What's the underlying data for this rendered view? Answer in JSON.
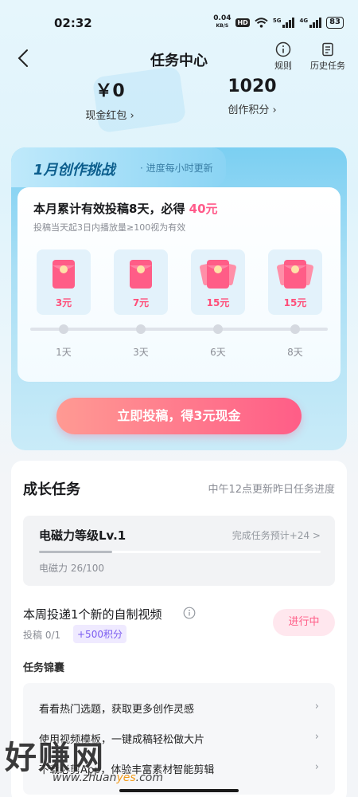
{
  "status_bar": {
    "time": "02:32",
    "net_speed_value": "0.04",
    "net_speed_unit": "KB/S",
    "hd": "HD",
    "signal1": "5G",
    "signal2": "4G",
    "battery": "83"
  },
  "nav": {
    "title": "任务中心",
    "rules": "规则",
    "history": "历史任务"
  },
  "stats": {
    "cash_value": "￥0",
    "cash_label": "现金红包 ›",
    "points_value": "1020",
    "points_label": "创作积分 ›"
  },
  "challenge": {
    "title": "1月创作挑战",
    "subtitle": "· 进度每小时更新",
    "headline_prefix": "本月累计有效投稿8天，必得 ",
    "headline_amount": "40元",
    "note": "投稿当天起3日内播放量≥100视为有效",
    "rewards": [
      {
        "amount": "3元",
        "day": "1天"
      },
      {
        "amount": "7元",
        "day": "3天"
      },
      {
        "amount": "15元",
        "day": "6天"
      },
      {
        "amount": "15元",
        "day": "8天"
      }
    ],
    "cta": "立即投稿，得3元现金"
  },
  "growth": {
    "title": "成长任务",
    "hint": "中午12点更新昨日任务进度",
    "level_name": "电磁力等级Lv.1",
    "level_link": "完成任务预计+24 >",
    "level_value": "电磁力 26/100",
    "level_progress": 0.26,
    "task_title": "本周投递1个新的自制视频",
    "task_progress": "投稿 0/1",
    "task_points": "+500积分",
    "task_status": "进行中",
    "bag_title": "任务锦囊",
    "bag_items": [
      "看看热门选题，获取更多创作灵感",
      "使用视频模板，一键成稿轻松做大片",
      "下载必剪App，体验丰富素材智能剪辑"
    ]
  },
  "watermark": {
    "brand": "好赚网",
    "url_a": "www.zhuan",
    "url_b": "yes",
    "url_c": ".com"
  },
  "colors": {
    "accent_pink": "#ff5d87",
    "challenge_blue": "#7bcff2",
    "points_purple": "#7b5cf0"
  }
}
